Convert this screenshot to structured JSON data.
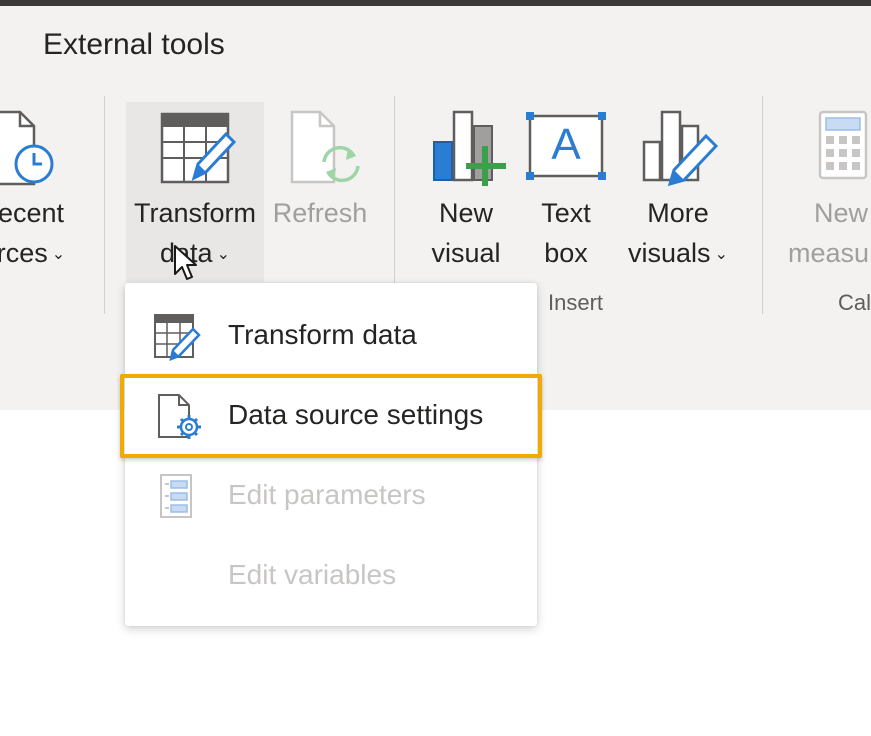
{
  "ribbon": {
    "tab_title": "External tools",
    "buttons": {
      "recent_sources": {
        "line1": "ecent",
        "line2": "rces",
        "icon": "recent-sources-icon"
      },
      "transform_data": {
        "line1": "Transform",
        "line2": "data",
        "icon": "transform-data-icon"
      },
      "refresh": {
        "line1": "Refresh",
        "icon": "refresh-icon"
      },
      "new_visual": {
        "line1": "New",
        "line2": "visual",
        "icon": "new-visual-icon"
      },
      "text_box": {
        "line1": "Text",
        "line2": "box",
        "icon": "text-box-icon",
        "glyph": "A"
      },
      "more_visuals": {
        "line1": "More",
        "line2": "visuals",
        "icon": "more-visuals-icon"
      },
      "new_measure": {
        "line1": "New",
        "line2": "measu",
        "icon": "calculator-icon"
      }
    },
    "groups": {
      "insert": "Insert",
      "calculations": "Cal"
    },
    "chevron": "⌄"
  },
  "menu": {
    "items": [
      {
        "label": "Transform data",
        "icon": "transform-data-icon",
        "enabled": true
      },
      {
        "label": "Data source settings",
        "icon": "data-source-settings-icon",
        "enabled": true,
        "highlighted": true
      },
      {
        "label": "Edit parameters",
        "icon": "edit-parameters-icon",
        "enabled": false
      },
      {
        "label": "Edit variables",
        "icon": "",
        "enabled": false
      }
    ]
  },
  "colors": {
    "ribbon_bg": "#f3f2f1",
    "highlight_border": "#f0aa00",
    "accent_blue": "#2b7cd3",
    "accent_green": "#3aa04a",
    "disabled_text": "#a19f9d"
  }
}
